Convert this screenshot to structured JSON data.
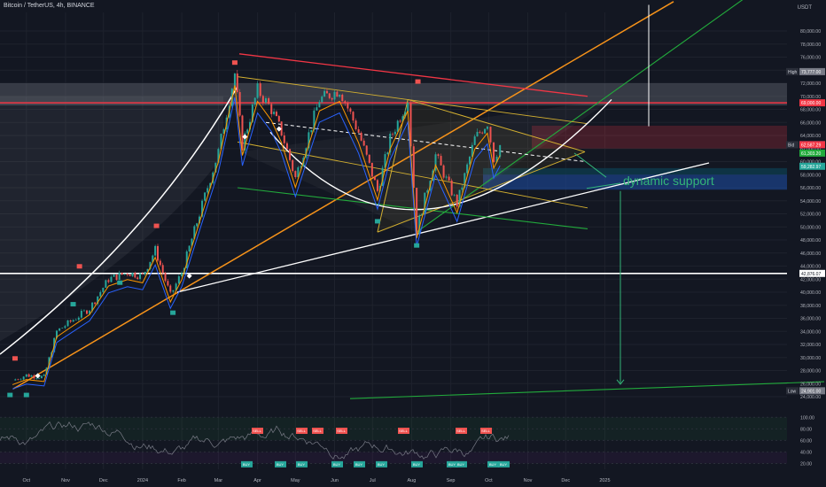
{
  "header": {
    "symbol_line": "Bitcoin / TetherUS, 4h, BINANCE"
  },
  "colors": {
    "background": "#131722",
    "grid": "#1e222d",
    "text": "#b2b5be",
    "candle_up": "#26a69a",
    "candle_down": "#ef5350",
    "resistance": "#f23645",
    "support": "#ffffff",
    "trend_orange": "#f7931a",
    "channel_green": "#22ab3c",
    "blue_zone": "#1e4fa8",
    "annotation": "#33b578"
  },
  "chart_data": {
    "type": "line",
    "title": "",
    "xlabel": "",
    "ylabel": "USDT",
    "ylim": [
      22000,
      84000
    ],
    "x_ticks": [
      "Oct",
      "Nov",
      "Dec",
      "2024",
      "Feb",
      "Mar",
      "Apr",
      "May",
      "Jun",
      "Jul",
      "Aug",
      "Sep",
      "Oct",
      "Nov",
      "Dec",
      "2025"
    ],
    "y_ticks": [
      "80,000.00",
      "78,000.00",
      "76,000.00",
      "74,000.00",
      "72,000.00",
      "70,000.00",
      "68,000.00",
      "66,000.00",
      "64,000.00",
      "62,000.00",
      "60,000.00",
      "58,000.00",
      "56,000.00",
      "54,000.00",
      "52,000.00",
      "50,000.00",
      "48,000.00",
      "46,000.00",
      "44,000.00",
      "42,000.00",
      "40,000.00",
      "38,000.00",
      "36,000.00",
      "34,000.00",
      "32,000.00",
      "30,000.00",
      "28,000.00",
      "26,000.00",
      "24,000.00"
    ],
    "series": [
      {
        "x": [
          "2023-09-20",
          "2023-10-01",
          "2023-10-15",
          "2023-10-25",
          "2023-11-05",
          "2023-11-20",
          "2023-12-05",
          "2023-12-20",
          "2024-01-01",
          "2024-01-11",
          "2024-01-23",
          "2024-02-01",
          "2024-02-15",
          "2024-03-01",
          "2024-03-14",
          "2024-03-20",
          "2024-04-01",
          "2024-04-12",
          "2024-04-20",
          "2024-05-01",
          "2024-05-20",
          "2024-06-05",
          "2024-06-20",
          "2024-07-05",
          "2024-07-15",
          "2024-07-29",
          "2024-08-05",
          "2024-08-20",
          "2024-09-06",
          "2024-09-20",
          "2024-09-30",
          "2024-10-05",
          "2024-10-10"
        ],
        "values": [
          26500,
          27300,
          27000,
          34000,
          35500,
          37500,
          42000,
          43000,
          42500,
          46500,
          39500,
          43000,
          52000,
          61500,
          73500,
          62500,
          71000,
          68000,
          64500,
          57500,
          69500,
          71000,
          64500,
          55500,
          63500,
          69500,
          49500,
          61000,
          53500,
          63500,
          66000,
          60500,
          62500
        ]
      }
    ],
    "price_labels": [
      {
        "label": "High",
        "value": "73,777.00"
      },
      {
        "label": "",
        "value": "69,000.00"
      },
      {
        "label": "Ask",
        "value": "62,587.29"
      },
      {
        "label": "Bid",
        "value": "62,587.28"
      },
      {
        "label": "",
        "value": "62,587.29"
      },
      {
        "label": "",
        "value": "61,303.20"
      },
      {
        "label": "",
        "value": "59,282.97"
      },
      {
        "label": "",
        "value": "42,876.07"
      },
      {
        "label": "Low",
        "value": "24,901.00"
      }
    ],
    "levels": {
      "resistance": 69000,
      "support": 42876
    },
    "annotations": [
      "dynamic support"
    ],
    "signal_labels": [
      "BUY",
      "SELL"
    ],
    "indicator": {
      "ylim": [
        10,
        105
      ],
      "y_ticks": [
        "100.00",
        "80.00",
        "60.00",
        "40.00",
        "20.00"
      ]
    },
    "legend": "none",
    "grid": true
  }
}
